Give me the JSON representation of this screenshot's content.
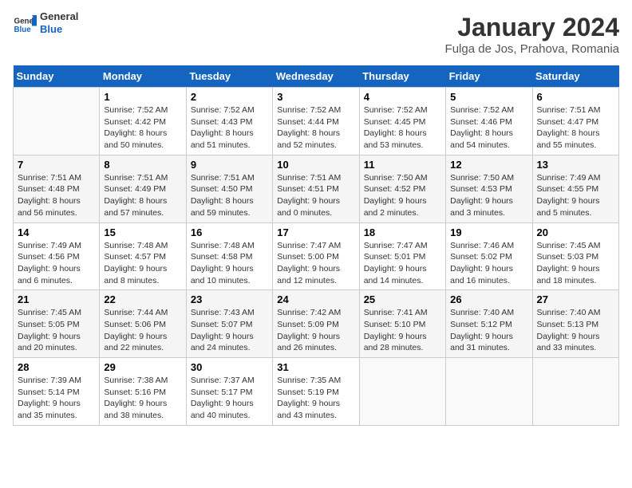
{
  "header": {
    "logo_general": "General",
    "logo_blue": "Blue",
    "month_title": "January 2024",
    "location": "Fulga de Jos, Prahova, Romania"
  },
  "weekdays": [
    "Sunday",
    "Monday",
    "Tuesday",
    "Wednesday",
    "Thursday",
    "Friday",
    "Saturday"
  ],
  "weeks": [
    [
      {
        "day": "",
        "sunrise": "",
        "sunset": "",
        "daylight": ""
      },
      {
        "day": "1",
        "sunrise": "Sunrise: 7:52 AM",
        "sunset": "Sunset: 4:42 PM",
        "daylight": "Daylight: 8 hours and 50 minutes."
      },
      {
        "day": "2",
        "sunrise": "Sunrise: 7:52 AM",
        "sunset": "Sunset: 4:43 PM",
        "daylight": "Daylight: 8 hours and 51 minutes."
      },
      {
        "day": "3",
        "sunrise": "Sunrise: 7:52 AM",
        "sunset": "Sunset: 4:44 PM",
        "daylight": "Daylight: 8 hours and 52 minutes."
      },
      {
        "day": "4",
        "sunrise": "Sunrise: 7:52 AM",
        "sunset": "Sunset: 4:45 PM",
        "daylight": "Daylight: 8 hours and 53 minutes."
      },
      {
        "day": "5",
        "sunrise": "Sunrise: 7:52 AM",
        "sunset": "Sunset: 4:46 PM",
        "daylight": "Daylight: 8 hours and 54 minutes."
      },
      {
        "day": "6",
        "sunrise": "Sunrise: 7:51 AM",
        "sunset": "Sunset: 4:47 PM",
        "daylight": "Daylight: 8 hours and 55 minutes."
      }
    ],
    [
      {
        "day": "7",
        "sunrise": "Sunrise: 7:51 AM",
        "sunset": "Sunset: 4:48 PM",
        "daylight": "Daylight: 8 hours and 56 minutes."
      },
      {
        "day": "8",
        "sunrise": "Sunrise: 7:51 AM",
        "sunset": "Sunset: 4:49 PM",
        "daylight": "Daylight: 8 hours and 57 minutes."
      },
      {
        "day": "9",
        "sunrise": "Sunrise: 7:51 AM",
        "sunset": "Sunset: 4:50 PM",
        "daylight": "Daylight: 8 hours and 59 minutes."
      },
      {
        "day": "10",
        "sunrise": "Sunrise: 7:51 AM",
        "sunset": "Sunset: 4:51 PM",
        "daylight": "Daylight: 9 hours and 0 minutes."
      },
      {
        "day": "11",
        "sunrise": "Sunrise: 7:50 AM",
        "sunset": "Sunset: 4:52 PM",
        "daylight": "Daylight: 9 hours and 2 minutes."
      },
      {
        "day": "12",
        "sunrise": "Sunrise: 7:50 AM",
        "sunset": "Sunset: 4:53 PM",
        "daylight": "Daylight: 9 hours and 3 minutes."
      },
      {
        "day": "13",
        "sunrise": "Sunrise: 7:49 AM",
        "sunset": "Sunset: 4:55 PM",
        "daylight": "Daylight: 9 hours and 5 minutes."
      }
    ],
    [
      {
        "day": "14",
        "sunrise": "Sunrise: 7:49 AM",
        "sunset": "Sunset: 4:56 PM",
        "daylight": "Daylight: 9 hours and 6 minutes."
      },
      {
        "day": "15",
        "sunrise": "Sunrise: 7:48 AM",
        "sunset": "Sunset: 4:57 PM",
        "daylight": "Daylight: 9 hours and 8 minutes."
      },
      {
        "day": "16",
        "sunrise": "Sunrise: 7:48 AM",
        "sunset": "Sunset: 4:58 PM",
        "daylight": "Daylight: 9 hours and 10 minutes."
      },
      {
        "day": "17",
        "sunrise": "Sunrise: 7:47 AM",
        "sunset": "Sunset: 5:00 PM",
        "daylight": "Daylight: 9 hours and 12 minutes."
      },
      {
        "day": "18",
        "sunrise": "Sunrise: 7:47 AM",
        "sunset": "Sunset: 5:01 PM",
        "daylight": "Daylight: 9 hours and 14 minutes."
      },
      {
        "day": "19",
        "sunrise": "Sunrise: 7:46 AM",
        "sunset": "Sunset: 5:02 PM",
        "daylight": "Daylight: 9 hours and 16 minutes."
      },
      {
        "day": "20",
        "sunrise": "Sunrise: 7:45 AM",
        "sunset": "Sunset: 5:03 PM",
        "daylight": "Daylight: 9 hours and 18 minutes."
      }
    ],
    [
      {
        "day": "21",
        "sunrise": "Sunrise: 7:45 AM",
        "sunset": "Sunset: 5:05 PM",
        "daylight": "Daylight: 9 hours and 20 minutes."
      },
      {
        "day": "22",
        "sunrise": "Sunrise: 7:44 AM",
        "sunset": "Sunset: 5:06 PM",
        "daylight": "Daylight: 9 hours and 22 minutes."
      },
      {
        "day": "23",
        "sunrise": "Sunrise: 7:43 AM",
        "sunset": "Sunset: 5:07 PM",
        "daylight": "Daylight: 9 hours and 24 minutes."
      },
      {
        "day": "24",
        "sunrise": "Sunrise: 7:42 AM",
        "sunset": "Sunset: 5:09 PM",
        "daylight": "Daylight: 9 hours and 26 minutes."
      },
      {
        "day": "25",
        "sunrise": "Sunrise: 7:41 AM",
        "sunset": "Sunset: 5:10 PM",
        "daylight": "Daylight: 9 hours and 28 minutes."
      },
      {
        "day": "26",
        "sunrise": "Sunrise: 7:40 AM",
        "sunset": "Sunset: 5:12 PM",
        "daylight": "Daylight: 9 hours and 31 minutes."
      },
      {
        "day": "27",
        "sunrise": "Sunrise: 7:40 AM",
        "sunset": "Sunset: 5:13 PM",
        "daylight": "Daylight: 9 hours and 33 minutes."
      }
    ],
    [
      {
        "day": "28",
        "sunrise": "Sunrise: 7:39 AM",
        "sunset": "Sunset: 5:14 PM",
        "daylight": "Daylight: 9 hours and 35 minutes."
      },
      {
        "day": "29",
        "sunrise": "Sunrise: 7:38 AM",
        "sunset": "Sunset: 5:16 PM",
        "daylight": "Daylight: 9 hours and 38 minutes."
      },
      {
        "day": "30",
        "sunrise": "Sunrise: 7:37 AM",
        "sunset": "Sunset: 5:17 PM",
        "daylight": "Daylight: 9 hours and 40 minutes."
      },
      {
        "day": "31",
        "sunrise": "Sunrise: 7:35 AM",
        "sunset": "Sunset: 5:19 PM",
        "daylight": "Daylight: 9 hours and 43 minutes."
      },
      {
        "day": "",
        "sunrise": "",
        "sunset": "",
        "daylight": ""
      },
      {
        "day": "",
        "sunrise": "",
        "sunset": "",
        "daylight": ""
      },
      {
        "day": "",
        "sunrise": "",
        "sunset": "",
        "daylight": ""
      }
    ]
  ]
}
